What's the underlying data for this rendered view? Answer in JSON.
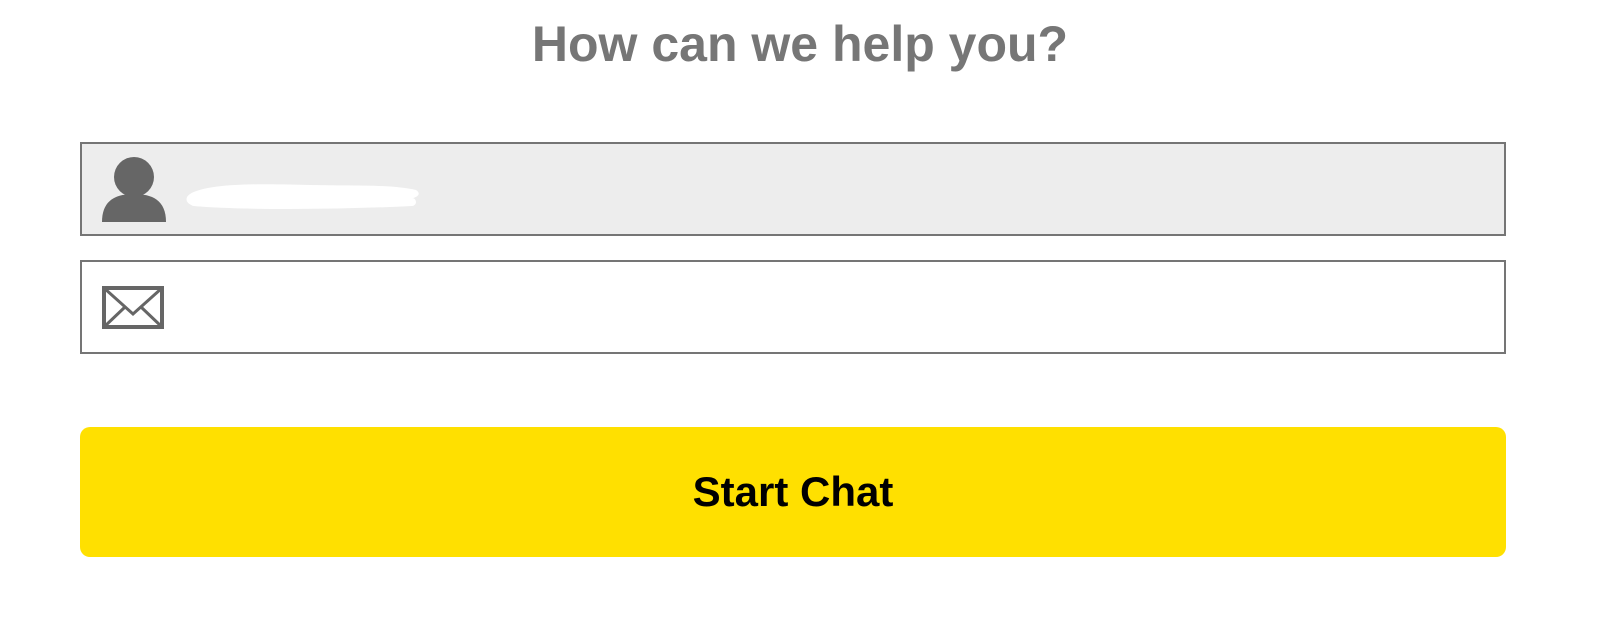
{
  "form": {
    "heading": "How can we help you?",
    "name_field": {
      "value": "",
      "placeholder": "",
      "icon": "user-icon"
    },
    "email_field": {
      "value": "",
      "placeholder": "",
      "icon": "envelope-icon"
    },
    "start_chat_label": "Start Chat"
  },
  "colors": {
    "heading": "#767676",
    "field_border": "#757575",
    "name_field_background": "#ededed",
    "icon": "#666666",
    "button_background": "#ffe000",
    "button_text": "#000000"
  }
}
